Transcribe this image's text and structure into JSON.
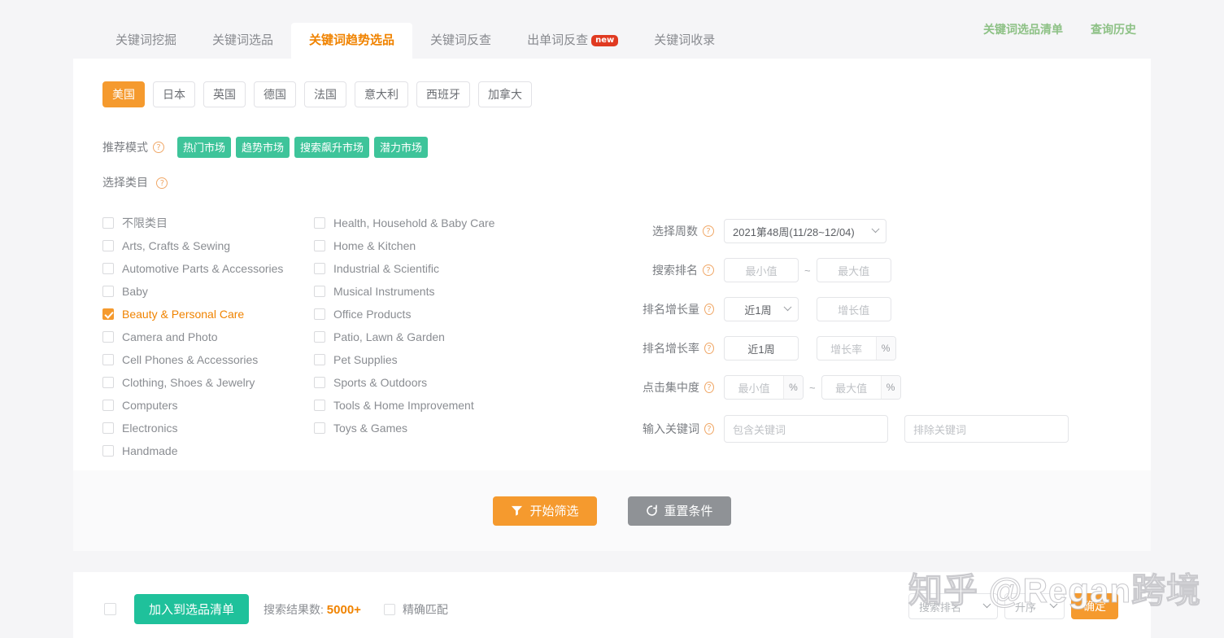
{
  "tabs": [
    {
      "label": "关键词挖掘",
      "active": false,
      "badge": ""
    },
    {
      "label": "关键词选品",
      "active": false,
      "badge": ""
    },
    {
      "label": "关键词趋势选品",
      "active": true,
      "badge": ""
    },
    {
      "label": "关键词反查",
      "active": false,
      "badge": ""
    },
    {
      "label": "出单词反查",
      "active": false,
      "badge": "new"
    },
    {
      "label": "关键词收录",
      "active": false,
      "badge": ""
    }
  ],
  "header_links": [
    {
      "label": "关键词选品清单"
    },
    {
      "label": "查询历史"
    }
  ],
  "countries": [
    {
      "label": "美国",
      "active": true
    },
    {
      "label": "日本",
      "active": false
    },
    {
      "label": "英国",
      "active": false
    },
    {
      "label": "德国",
      "active": false
    },
    {
      "label": "法国",
      "active": false
    },
    {
      "label": "意大利",
      "active": false
    },
    {
      "label": "西班牙",
      "active": false
    },
    {
      "label": "加拿大",
      "active": false
    }
  ],
  "recommend_mode": {
    "label": "推荐模式",
    "tags": [
      "热门市场",
      "趋势市场",
      "搜索飙升市场",
      "潜力市场"
    ]
  },
  "category": {
    "label": "选择类目",
    "col1": [
      {
        "label": "不限类目",
        "checked": false
      },
      {
        "label": "Arts, Crafts & Sewing",
        "checked": false
      },
      {
        "label": "Automotive Parts & Accessories",
        "checked": false
      },
      {
        "label": "Baby",
        "checked": false
      },
      {
        "label": "Beauty & Personal Care",
        "checked": true
      },
      {
        "label": "Camera and Photo",
        "checked": false
      },
      {
        "label": "Cell Phones & Accessories",
        "checked": false
      },
      {
        "label": "Clothing, Shoes & Jewelry",
        "checked": false
      },
      {
        "label": "Computers",
        "checked": false
      },
      {
        "label": "Electronics",
        "checked": false
      },
      {
        "label": "Handmade",
        "checked": false
      }
    ],
    "col2": [
      {
        "label": "Health, Household & Baby Care",
        "checked": false
      },
      {
        "label": "Home & Kitchen",
        "checked": false
      },
      {
        "label": "Industrial & Scientific",
        "checked": false
      },
      {
        "label": "Musical Instruments",
        "checked": false
      },
      {
        "label": "Office Products",
        "checked": false
      },
      {
        "label": "Patio, Lawn & Garden",
        "checked": false
      },
      {
        "label": "Pet Supplies",
        "checked": false
      },
      {
        "label": "Sports & Outdoors",
        "checked": false
      },
      {
        "label": "Tools & Home Improvement",
        "checked": false
      },
      {
        "label": "Toys & Games",
        "checked": false
      }
    ]
  },
  "filters": {
    "week": {
      "label": "选择周数",
      "value": "2021第48周(11/28~12/04)"
    },
    "search_rank": {
      "label": "搜索排名",
      "min_placeholder": "最小值",
      "max_placeholder": "最大值",
      "separator": "~"
    },
    "rank_growth_amount": {
      "label": "排名增长量",
      "period": "近1周",
      "value_placeholder": "增长值"
    },
    "rank_growth_rate": {
      "label": "排名增长率",
      "period": "近1周",
      "value_placeholder": "增长率",
      "unit": "%"
    },
    "click_concentration": {
      "label": "点击集中度",
      "min_placeholder": "最小值",
      "max_placeholder": "最大值",
      "unit": "%",
      "separator": "~"
    },
    "keywords": {
      "label": "输入关键词",
      "include_placeholder": "包含关键词",
      "exclude_placeholder": "排除关键词"
    }
  },
  "actions": {
    "filter_label": "开始筛选",
    "reset_label": "重置条件"
  },
  "bottom": {
    "add_to_list_label": "加入到选品清单",
    "result_prefix": "搜索结果数:",
    "result_count": "5000+",
    "exact_match_label": "精确匹配",
    "sort_field": "搜索排名",
    "sort_order": "升序",
    "confirm_label": "确定"
  },
  "watermark": "知乎 @Regan跨境",
  "colors": {
    "accent_orange": "#f59a2e",
    "accent_orange_text": "#f08300",
    "green_tag": "#3ec49a",
    "green_button": "#1fc19b",
    "green_link": "#8dc185",
    "badge_red": "#e03a21",
    "gray_button": "#8f9296"
  }
}
